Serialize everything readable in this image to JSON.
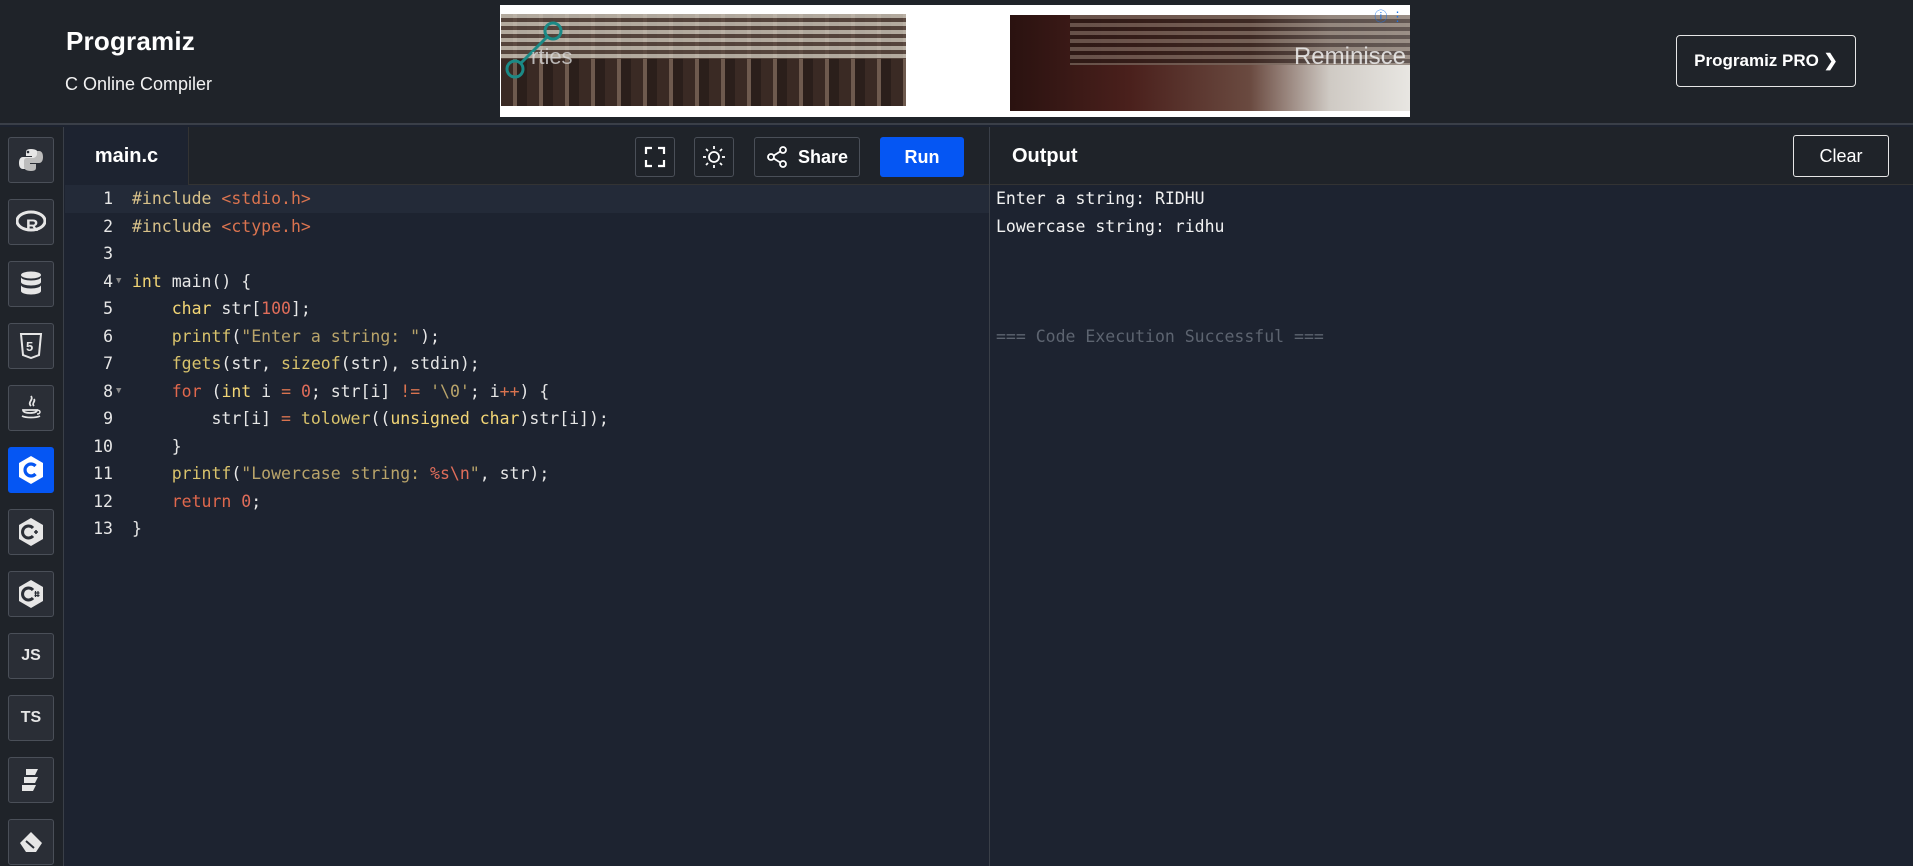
{
  "header": {
    "logo": "Programiz",
    "subtitle": "C Online Compiler",
    "pro_button": "Programiz PRO ❯"
  },
  "ad": {
    "text_left": "rties",
    "text_right": "Reminisce"
  },
  "sidebar": {
    "items": [
      {
        "name": "python",
        "label": ""
      },
      {
        "name": "r",
        "label": ""
      },
      {
        "name": "sql",
        "label": ""
      },
      {
        "name": "html",
        "label": ""
      },
      {
        "name": "java",
        "label": ""
      },
      {
        "name": "c",
        "label": "",
        "active": true
      },
      {
        "name": "cpp",
        "label": ""
      },
      {
        "name": "csharp",
        "label": ""
      },
      {
        "name": "js",
        "label": "JS"
      },
      {
        "name": "ts",
        "label": "TS"
      },
      {
        "name": "go",
        "label": ""
      },
      {
        "name": "swift",
        "label": ""
      }
    ]
  },
  "editor": {
    "file_tab": "main.c",
    "share_label": "Share",
    "run_label": "Run",
    "line_numbers": [
      "1",
      "2",
      "3",
      "4",
      "5",
      "6",
      "7",
      "8",
      "9",
      "10",
      "11",
      "12",
      "13"
    ]
  },
  "output": {
    "title": "Output",
    "clear_label": "Clear",
    "lines": [
      "Enter a string: RIDHU",
      "Lowercase string: ridhu",
      "",
      "",
      "",
      "=== Code Execution Successful ==="
    ]
  },
  "colors": {
    "accent": "#0556f3",
    "background": "#1d2330",
    "bar": "#1f2329"
  }
}
